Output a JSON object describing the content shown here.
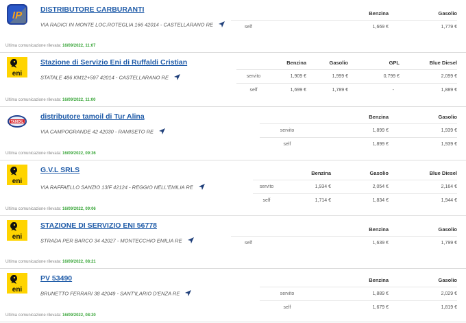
{
  "comm_label": "Ultima comunicazione rilevata:",
  "stations": [
    {
      "brand_icon": "ip-logo-icon",
      "name": "DISTRIBUTORE CARBURANTI",
      "address": "VIA RADICI IN MONTE LOC.ROTEGLIA 166 42014 - CASTELLARANO RE",
      "date": "16/09/2022, 11:07",
      "columns": [
        "",
        "Benzina",
        "Gasolio"
      ],
      "rows": [
        {
          "service": "self",
          "prices": [
            "1,669 €",
            "1,779 €"
          ]
        }
      ]
    },
    {
      "brand_icon": "eni-logo-icon",
      "name": "Stazione di Servizio Eni di Ruffaldi Cristian",
      "address": "STATALE 486 KM12+597 42014 - CASTELLARANO RE",
      "date": "16/09/2022, 11:00",
      "columns": [
        "",
        "Benzina",
        "Gasolio",
        "GPL",
        "Blue Diesel"
      ],
      "rows": [
        {
          "service": "servito",
          "prices": [
            "1,909 €",
            "1,999 €",
            "0,799 €",
            "2,099 €"
          ]
        },
        {
          "service": "self",
          "prices": [
            "1,699 €",
            "1,789 €",
            "-",
            "1,889 €"
          ]
        }
      ]
    },
    {
      "brand_icon": "tamoil-logo-icon",
      "name": "distributore tamoil di Tur Alina",
      "address": "VIA CAMPOGRANDE 42 42030 - RAMISETO RE",
      "date": "16/09/2022, 09:36",
      "columns": [
        "",
        "Benzina",
        "Gasolio"
      ],
      "rows": [
        {
          "service": "servito",
          "prices": [
            "1,899 €",
            "1,939 €"
          ]
        },
        {
          "service": "self",
          "prices": [
            "1,899 €",
            "1,939 €"
          ]
        }
      ]
    },
    {
      "brand_icon": "eni-logo-icon",
      "name": "G.V.L SRLS",
      "address": "VIA RAFFAELLO SANZIO 13/F 42124 - REGGIO NELL'EMILIA RE",
      "date": "16/09/2022, 09:06",
      "columns": [
        "",
        "Benzina",
        "Gasolio",
        "Blue Diesel"
      ],
      "rows": [
        {
          "service": "servito",
          "prices": [
            "1,934 €",
            "2,054 €",
            "2,164 €"
          ]
        },
        {
          "service": "self",
          "prices": [
            "1,714 €",
            "1,834 €",
            "1,944 €"
          ]
        }
      ]
    },
    {
      "brand_icon": "eni-logo-icon",
      "name": "STAZIONE DI SERVIZIO ENI 56778",
      "address": "STRADA PER BARCO 34 42027 - MONTECCHIO EMILIA RE",
      "date": "16/09/2022, 08:21",
      "columns": [
        "",
        "Benzina",
        "Gasolio"
      ],
      "rows": [
        {
          "service": "self",
          "prices": [
            "1,639 €",
            "1,799 €"
          ]
        }
      ]
    },
    {
      "brand_icon": "eni-logo-icon",
      "name": "PV 53490",
      "address": "BRUNETTO FERRARI 38 42049 - SANT'ILARIO D'ENZA RE",
      "date": "16/09/2022, 08:20",
      "columns": [
        "",
        "Benzina",
        "Gasolio"
      ],
      "rows": [
        {
          "service": "servito",
          "prices": [
            "1,889 €",
            "2,029 €"
          ]
        },
        {
          "service": "self",
          "prices": [
            "1,679 €",
            "1,819 €"
          ]
        }
      ]
    }
  ]
}
